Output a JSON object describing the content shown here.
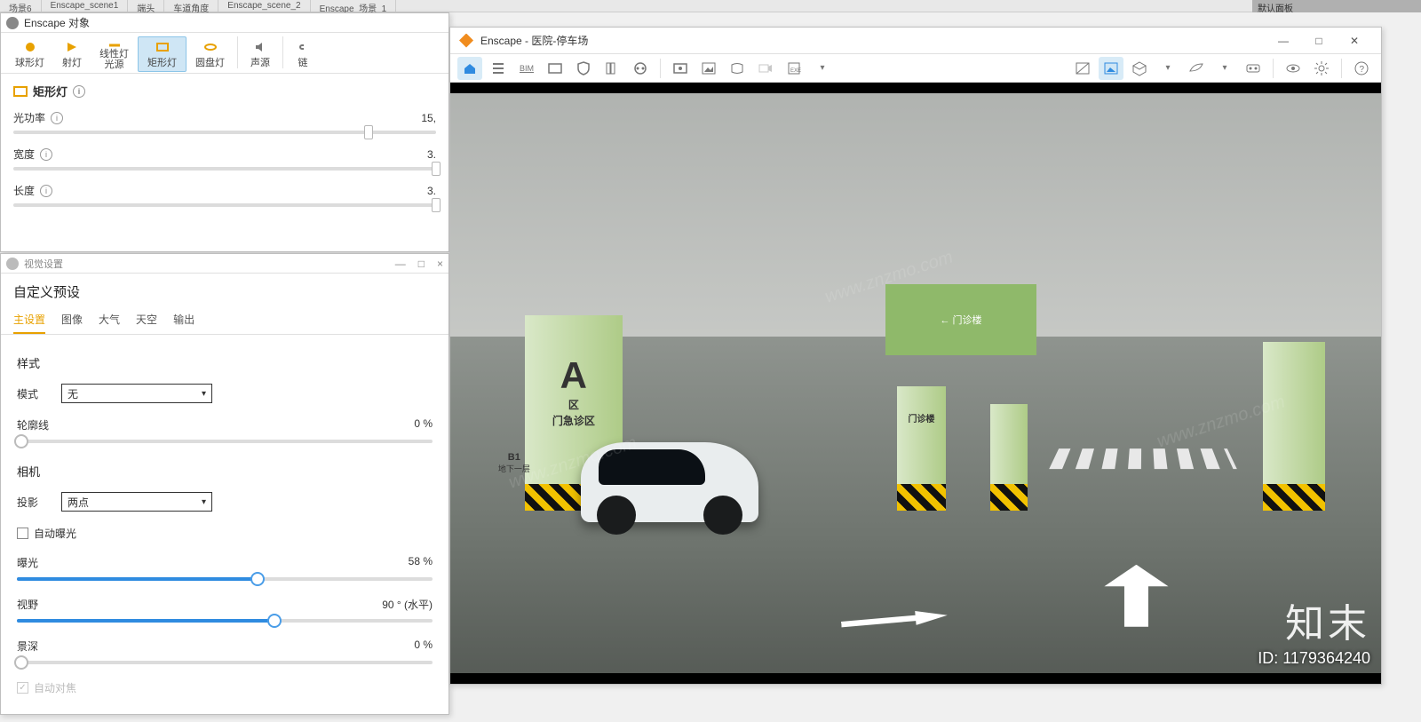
{
  "app_tabs": [
    "场景6",
    "Enscape_scene1",
    "端头",
    "车道角度",
    "Enscape_scene_2",
    "Enscape_场景_1"
  ],
  "top_right_panel": "默认面板",
  "objects_window": {
    "title": "Enscape 对象",
    "toolbar": {
      "sphere": "球形灯",
      "spot": "射灯",
      "linear": "线性灯\n光源",
      "rect": "矩形灯",
      "disk": "圆盘灯",
      "sound": "声源",
      "link": "链"
    },
    "section_title": "矩形灯",
    "rows": {
      "power": {
        "label": "光功率",
        "value": "15,"
      },
      "width": {
        "label": "宽度",
        "value": "3."
      },
      "length": {
        "label": "长度",
        "value": "3."
      }
    }
  },
  "visual_window": {
    "title": "视觉设置",
    "min": "—",
    "close": "×",
    "heading": "自定义预设",
    "tabs": {
      "main": "主设置",
      "image": "图像",
      "atmo": "大气",
      "sky": "天空",
      "output": "输出"
    },
    "style_section": "样式",
    "mode_label": "模式",
    "mode_value": "无",
    "outline": {
      "label": "轮廓线",
      "value": "0 %"
    },
    "camera_section": "相机",
    "projection_label": "投影",
    "projection_value": "两点",
    "auto_exposure": "自动曝光",
    "exposure": {
      "label": "曝光",
      "value": "58 %"
    },
    "fov": {
      "label": "视野",
      "value": "90 ° (水平)"
    },
    "dof": {
      "label": "景深",
      "value": "0 %"
    },
    "auto_focus": "自动对焦"
  },
  "viewport": {
    "title": "Enscape - 医院-停车场",
    "scene": {
      "pillar_a_big": "A",
      "pillar_a_small": "区",
      "pillar_a_sub": "门急诊区",
      "b1_label": "B1",
      "b1_sub": "地下一层",
      "clinic_label": "门诊楼",
      "back_wall_label": "← 门诊楼"
    },
    "watermark_brand": "知末",
    "watermark_id": "ID: 1179364240",
    "watermark_url": "www.znzmo.com"
  }
}
